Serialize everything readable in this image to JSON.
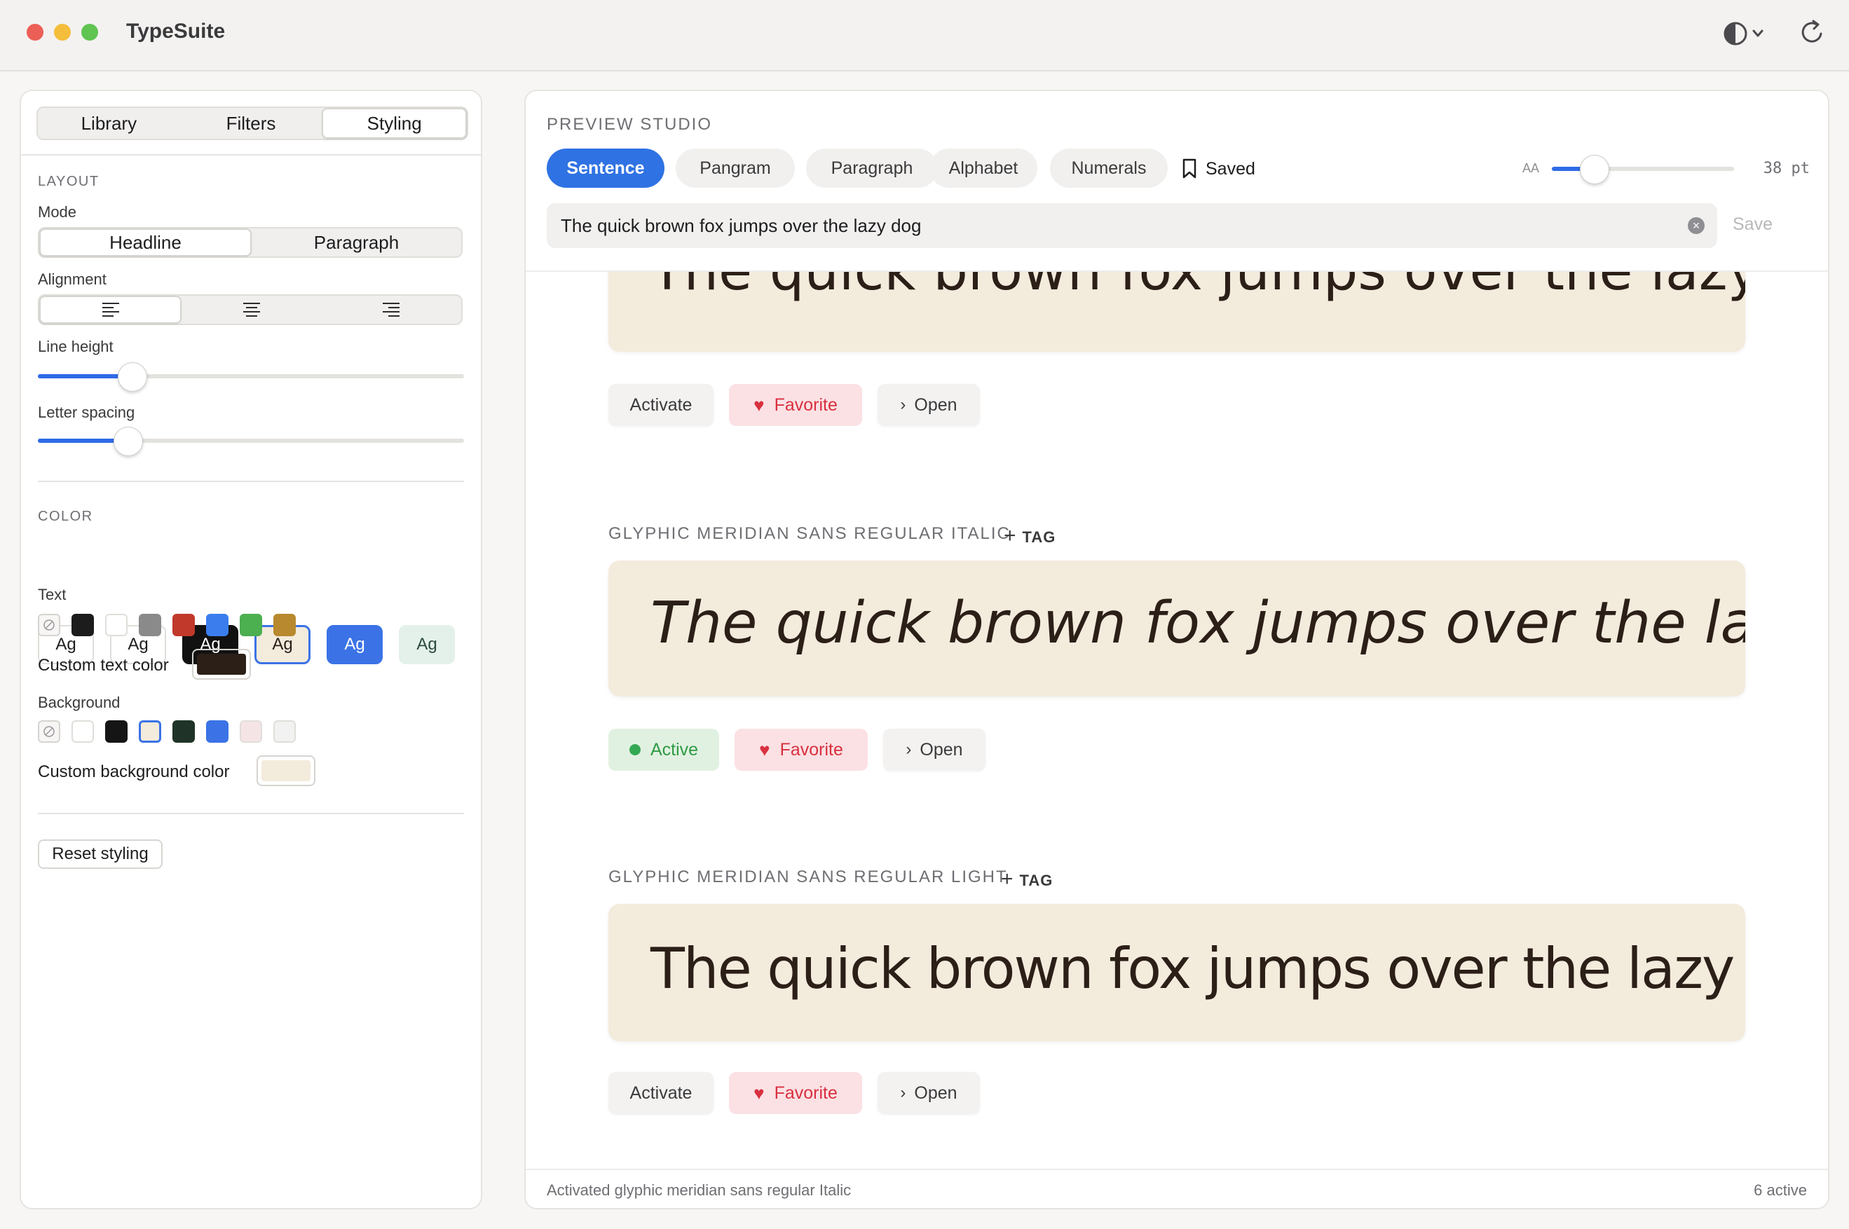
{
  "app": {
    "title": "TypeSuite"
  },
  "sidebar": {
    "tabs": [
      "Library",
      "Filters",
      "Styling"
    ],
    "active_tab": "Styling",
    "layout": {
      "section_label": "LAYOUT",
      "mode_label": "Mode",
      "mode_options": [
        "Headline",
        "Paragraph"
      ],
      "mode_selected": "Headline",
      "alignment_label": "Alignment",
      "alignment_selected": "left",
      "line_height_label": "Line height",
      "line_height_value": 0.22,
      "letter_spacing_label": "Letter spacing",
      "letter_spacing_value": 0.21
    },
    "color": {
      "section_label": "COLOR",
      "preset_label": "Ag",
      "presets": [
        {
          "fg": "#1d1d1f",
          "bg": "#ffffff"
        },
        {
          "fg": "#1d1d1f",
          "bg": "#ffffff"
        },
        {
          "fg": "#ffffff",
          "bg": "#111111"
        },
        {
          "fg": "#2b1f18",
          "bg": "#f3ebdc",
          "selected": true
        },
        {
          "fg": "#ffffff",
          "bg": "#3b73e6"
        },
        {
          "fg": "#2c4a3e",
          "bg": "#e3f1ea"
        }
      ],
      "text_label": "Text",
      "text_swatches": [
        "none",
        "#1c1c1c",
        "#ffffff",
        "#8a8a8a",
        "#c0392b",
        "#3b7ded",
        "#4caf50",
        "#b8892e"
      ],
      "custom_text_label": "Custom text color",
      "custom_text_value": "#2b1f18",
      "background_label": "Background",
      "background_swatches": [
        "none",
        "#ffffff",
        "#151515",
        "#f3ebdc",
        "#1f3328",
        "#3b73e6",
        "#f5e4e6",
        "#f2f2f2"
      ],
      "background_selected": "#f3ebdc",
      "custom_bg_label": "Custom background color",
      "custom_bg_value": "#f3ebdc"
    },
    "reset_label": "Reset styling"
  },
  "main": {
    "section_title": "PREVIEW STUDIO",
    "pills": [
      "Sentence",
      "Pangram",
      "Paragraph",
      "Alphabet",
      "Numerals"
    ],
    "active_pill": "Sentence",
    "saved_label": "Saved",
    "size_small_label": "AA",
    "size_value": "38 pt",
    "size_slider_value": 0.23,
    "search_value": "The quick brown fox jumps over the lazy dog",
    "save_label": "Save",
    "sample_text": "The quick brown fox jumps over the lazy dog",
    "tag_label": "TAG",
    "fonts": [
      {
        "name": "",
        "actions": {
          "activate": "Activate",
          "favorite": "Favorite",
          "open": "Open"
        },
        "state": "inactive"
      },
      {
        "name": "GLYPHIC MERIDIAN SANS REGULAR ITALIC",
        "actions": {
          "activate": "Active",
          "favorite": "Favorite",
          "open": "Open"
        },
        "state": "active"
      },
      {
        "name": "GLYPHIC MERIDIAN SANS REGULAR LIGHT",
        "actions": {
          "activate": "Activate",
          "favorite": "Favorite",
          "open": "Open"
        },
        "state": "inactive"
      }
    ],
    "status_left": "Activated glyphic meridian sans regular Italic",
    "status_right": "6 active"
  }
}
